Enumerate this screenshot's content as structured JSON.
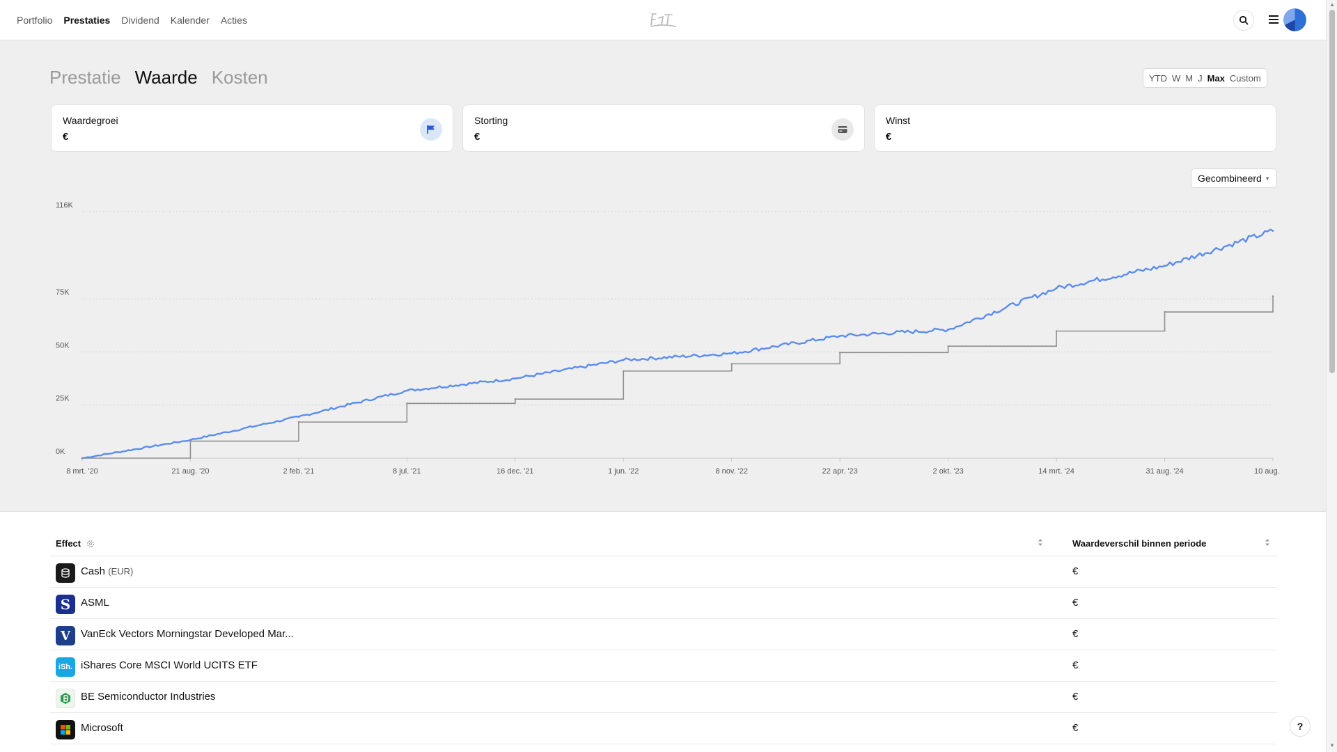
{
  "nav": {
    "items": [
      {
        "label": "Portfolio",
        "active": false
      },
      {
        "label": "Prestaties",
        "active": true
      },
      {
        "label": "Dividend",
        "active": false
      },
      {
        "label": "Kalender",
        "active": false
      },
      {
        "label": "Acties",
        "active": false
      }
    ],
    "logo_icon": "app-logo-icon",
    "search_icon": "search-icon",
    "menu_icon": "hamburger-menu-icon",
    "avatar_icon": "pie-avatar-icon"
  },
  "page_tabs": [
    {
      "label": "Prestatie",
      "active": false
    },
    {
      "label": "Waarde",
      "active": true
    },
    {
      "label": "Kosten",
      "active": false
    }
  ],
  "periods": [
    {
      "label": "YTD",
      "active": false
    },
    {
      "label": "W",
      "active": false
    },
    {
      "label": "M",
      "active": false
    },
    {
      "label": "J",
      "active": false
    },
    {
      "label": "Max",
      "active": true
    },
    {
      "label": "Custom",
      "active": false
    }
  ],
  "cards": [
    {
      "label": "Waardegroei",
      "value": "€",
      "icon": "flag-icon",
      "badge_color": "#dbe7f8",
      "icon_color": "#2a5bd7"
    },
    {
      "label": "Storting",
      "value": "€",
      "icon": "card-icon",
      "badge_color": "#e8e8e8",
      "icon_color": "#555555"
    },
    {
      "label": "Winst",
      "value": "€"
    }
  ],
  "combo_select": {
    "label": "Gecombineerd",
    "icon": "chevron-down-icon"
  },
  "chart_data": {
    "type": "line",
    "title": "",
    "xlabel": "",
    "ylabel": "",
    "x_tick_labels": [
      "8 mrt. '20",
      "21 aug. '20",
      "2 feb. '21",
      "8 jul. '21",
      "16 dec. '21",
      "1 jun. '22",
      "8 nov. '22",
      "22 apr. '23",
      "2 okt. '23",
      "14 mrt. '24",
      "31 aug. '24",
      "10 aug. '25"
    ],
    "y_tick_labels": [
      "0K",
      "25K",
      "50K",
      "75K",
      "116K"
    ],
    "y_tick_values": [
      0,
      25000,
      50000,
      75000,
      116000
    ],
    "ylim": [
      0,
      116000
    ],
    "grid": true,
    "colors": {
      "value_line": "#5b8def",
      "deposit_line": "#8f8f8f"
    },
    "x": [
      "8 mrt. '20",
      "21 aug. '20",
      "2 feb. '21",
      "8 jul. '21",
      "16 dec. '21",
      "1 jun. '22",
      "8 nov. '22",
      "22 apr. '23",
      "2 okt. '23",
      "14 mrt. '24",
      "31 aug. '24",
      "10 aug. '25"
    ],
    "series": [
      {
        "values": [
          0,
          8600,
          19500,
          31800,
          37500,
          46200,
          49300,
          57500,
          60500,
          80000,
          90500,
          107000
        ]
      },
      {
        "values": [
          0,
          8000,
          17000,
          25800,
          27800,
          41000,
          44400,
          49700,
          52700,
          59800,
          68800,
          76200
        ]
      }
    ]
  },
  "table": {
    "col_effect": "Effect",
    "col_value": "Waardeverschil binnen periode",
    "settings_icon": "gear-icon",
    "sort_icon": "sort-icon",
    "rows": [
      {
        "name": "Cash",
        "suffix": "(EUR)",
        "value": "€",
        "logo": "cash-stack-icon",
        "logo_bg": "#1a1a1a",
        "logo_text": ""
      },
      {
        "name": "ASML",
        "suffix": "",
        "value": "€",
        "logo": "asml-logo-icon",
        "logo_bg": "#1b2f8f",
        "logo_text": "S"
      },
      {
        "name": "VanEck Vectors Morningstar Developed Mar...",
        "suffix": "",
        "value": "€",
        "logo": "vaneck-logo-icon",
        "logo_bg": "#1d3f8a",
        "logo_text": "V"
      },
      {
        "name": "iShares Core MSCI World UCITS ETF",
        "suffix": "",
        "value": "€",
        "logo": "ishares-logo-icon",
        "logo_bg": "#1aa6e0",
        "logo_text": "iSh."
      },
      {
        "name": "BE Semiconductor Industries",
        "suffix": "",
        "value": "€",
        "logo": "besi-logo-icon",
        "logo_bg": "#eef5ee",
        "logo_text": ""
      },
      {
        "name": "Microsoft",
        "suffix": "",
        "value": "€",
        "logo": "microsoft-logo-icon",
        "logo_bg": "#111111",
        "logo_text": ""
      }
    ]
  },
  "help": {
    "label": "?"
  }
}
